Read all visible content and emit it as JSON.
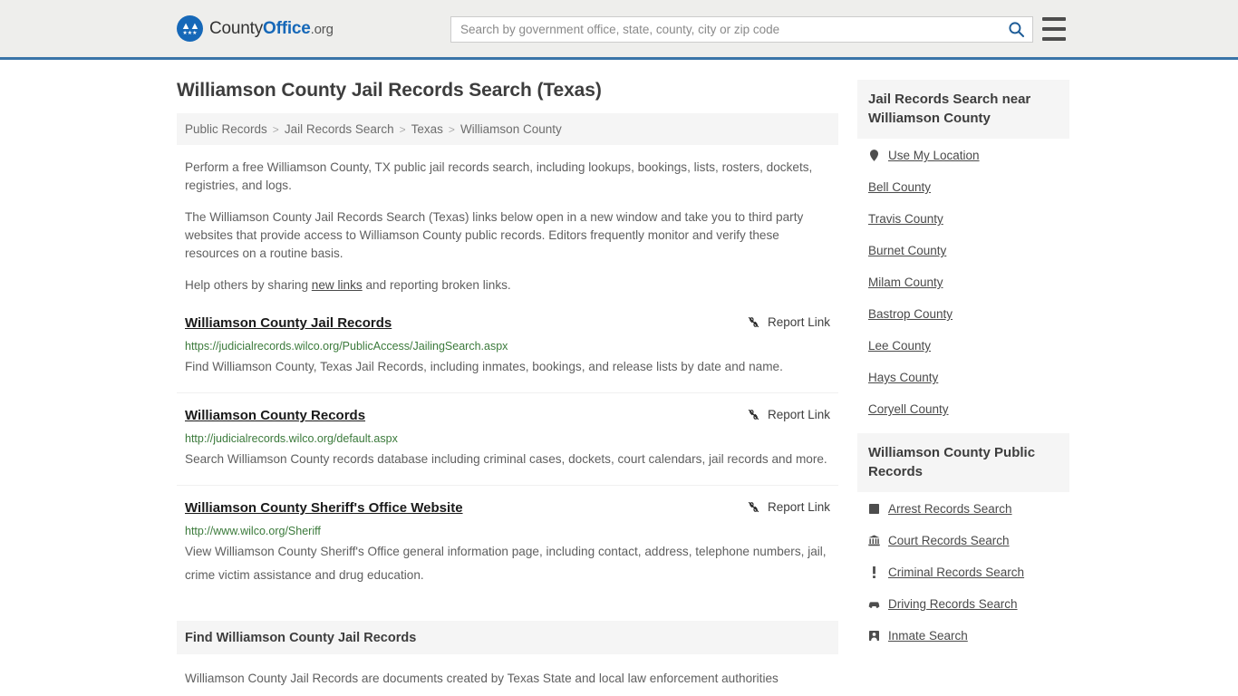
{
  "header": {
    "brand": {
      "part1": "County",
      "part2": "Office",
      "part3": ".org"
    },
    "search": {
      "placeholder": "Search by government office, state, county, city or zip code",
      "value": "",
      "submit_label": "Search"
    },
    "menu_label": "Menu"
  },
  "main": {
    "title": "Williamson County Jail Records Search (Texas)",
    "breadcrumb": [
      {
        "label": "Public Records",
        "current": false
      },
      {
        "label": "Jail Records Search",
        "current": false
      },
      {
        "label": "Texas",
        "current": false
      },
      {
        "label": "Williamson County",
        "current": true
      }
    ],
    "breadcrumb_separator": ">",
    "intro": [
      "Perform a free Williamson County, TX public jail records search, including lookups, bookings, lists, rosters, dockets, registries, and logs.",
      "The Williamson County Jail Records Search (Texas) links below open in a new window and take you to third party websites that provide access to Williamson County public records. Editors frequently monitor and verify these resources on a routine basis."
    ],
    "help_prefix": "Help others by sharing ",
    "help_link": "new links",
    "help_suffix": " and reporting broken links.",
    "report_link_label": "Report Link",
    "results": [
      {
        "title": "Williamson County Jail Records",
        "url": "https://judicialrecords.wilco.org/PublicAccess/JailingSearch.aspx",
        "description": "Find Williamson County, Texas Jail Records, including inmates, bookings, and release lists by date and name."
      },
      {
        "title": "Williamson County Records",
        "url": "http://judicialrecords.wilco.org/default.aspx",
        "description": "Search Williamson County records database including criminal cases, dockets, court calendars, jail records and more."
      },
      {
        "title": "Williamson County Sheriff's Office Website",
        "url": "http://www.wilco.org/Sheriff",
        "description": "View Williamson County Sheriff's Office general information page, including contact, address, telephone numbers, jail, crime victim assistance and drug education."
      }
    ],
    "section": {
      "heading": "Find Williamson County Jail Records",
      "body": "Williamson County Jail Records are documents created by Texas State and local law enforcement authorities"
    }
  },
  "sidebar": {
    "panels": [
      {
        "heading": "Jail Records Search near Williamson County",
        "items": [
          {
            "label": "Use My Location",
            "icon": "map-pin-icon"
          },
          {
            "label": "Bell County",
            "icon": ""
          },
          {
            "label": "Travis County",
            "icon": ""
          },
          {
            "label": "Burnet County",
            "icon": ""
          },
          {
            "label": "Milam County",
            "icon": ""
          },
          {
            "label": "Bastrop County",
            "icon": ""
          },
          {
            "label": "Lee County",
            "icon": ""
          },
          {
            "label": "Hays County",
            "icon": ""
          },
          {
            "label": "Coryell County",
            "icon": ""
          }
        ]
      },
      {
        "heading": "Williamson County Public Records",
        "items": [
          {
            "label": "Arrest Records Search",
            "icon": "square-icon"
          },
          {
            "label": "Court Records Search",
            "icon": "courthouse-icon"
          },
          {
            "label": "Criminal Records Search",
            "icon": "exclamation-icon"
          },
          {
            "label": "Driving Records Search",
            "icon": "car-icon"
          },
          {
            "label": "Inmate Search",
            "icon": "inmate-icon"
          }
        ]
      }
    ]
  },
  "colors": {
    "brand_blue": "#1668b8",
    "header_bg": "#eeeeec",
    "header_border": "#3a75a8",
    "url_green": "#3b7a3b",
    "panel_bg": "#f5f5f5",
    "body_text": "#5f5f5f"
  }
}
